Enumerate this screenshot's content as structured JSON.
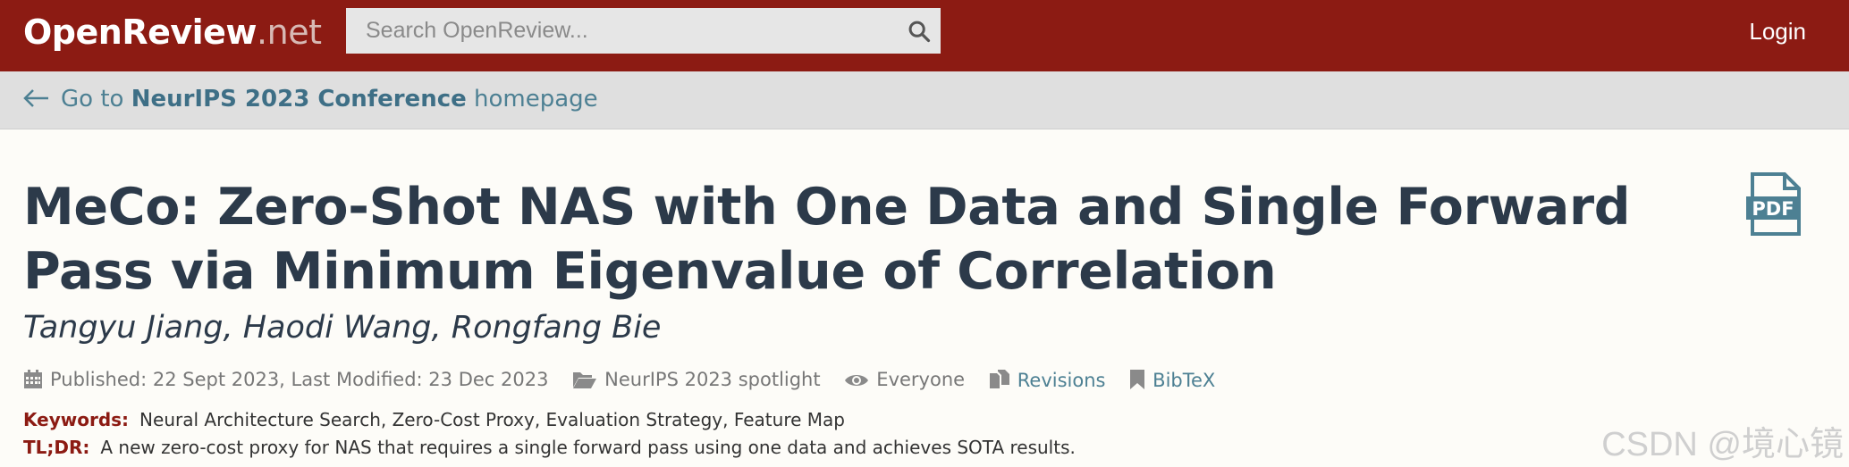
{
  "header": {
    "brand_main": "OpenReview",
    "brand_tld": ".net",
    "search_placeholder": "Search OpenReview...",
    "login_label": "Login"
  },
  "breadcrumb": {
    "prefix": "Go to ",
    "venue": "NeurIPS 2023 Conference",
    "suffix": " homepage"
  },
  "paper": {
    "title": "MeCo: Zero-Shot NAS with One Data and Single Forward Pass via Minimum Eigenvalue of Correlation",
    "pdf_label": "PDF",
    "authors": "Tangyu Jiang, Haodi Wang, Rongfang Bie",
    "dates": "Published: 22 Sept 2023, Last Modified: 23 Dec 2023",
    "venue": "NeurIPS 2023 spotlight",
    "readers": "Everyone",
    "revisions_label": "Revisions",
    "bibtex_label": "BibTeX",
    "keywords_label": "Keywords:",
    "keywords": "Neural Architecture Search, Zero-Cost Proxy, Evaluation Strategy, Feature Map",
    "tldr_label": "TL;DR:",
    "tldr": "A new zero-cost proxy for NAS that requires a single forward pass using one data and achieves SOTA results."
  },
  "watermark": "CSDN @境心镜"
}
